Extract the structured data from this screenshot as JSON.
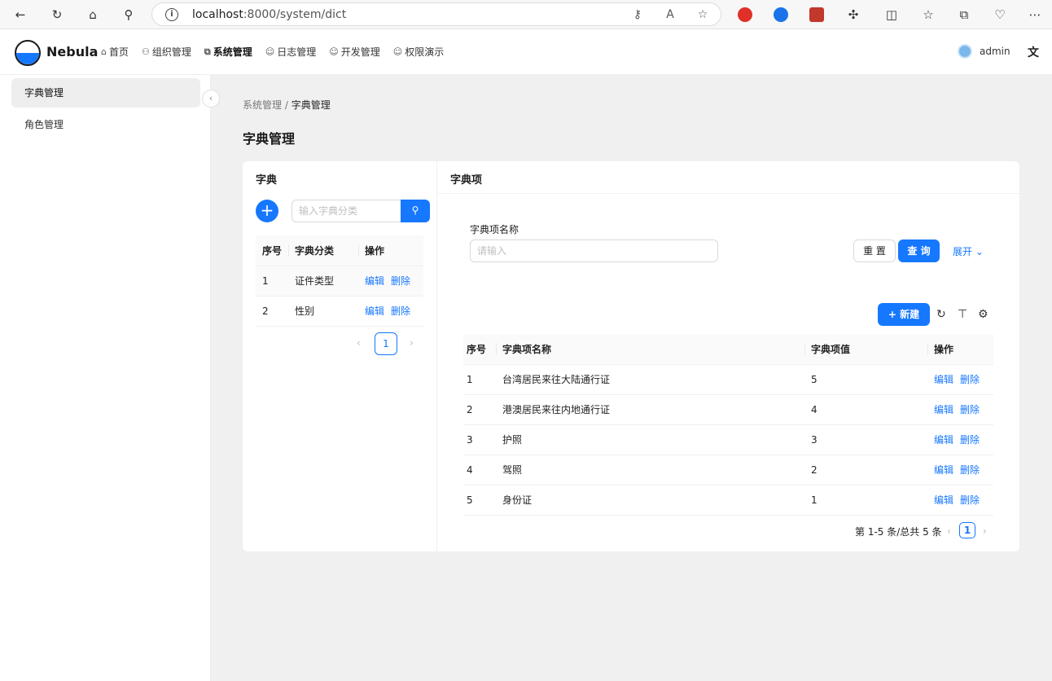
{
  "browser": {
    "url_host": "localhost",
    "url_path": ":8000/system/dict"
  },
  "header": {
    "brand": "Nebula",
    "nav": [
      {
        "label": "首页",
        "icon": "home-icon",
        "glyph": "⌂"
      },
      {
        "label": "组织管理",
        "icon": "org-icon",
        "glyph": "⚇"
      },
      {
        "label": "系统管理",
        "icon": "system-icon",
        "glyph": "⧉"
      },
      {
        "label": "日志管理",
        "icon": "check-circle-icon",
        "glyph": "☺"
      },
      {
        "label": "开发管理",
        "icon": "check-circle-icon",
        "glyph": "☺"
      },
      {
        "label": "权限演示",
        "icon": "check-circle-icon",
        "glyph": "☺"
      }
    ],
    "user": "admin"
  },
  "sidebar": {
    "items": [
      {
        "label": "字典管理"
      },
      {
        "label": "角色管理"
      }
    ]
  },
  "breadcrumb": {
    "parent": "系统管理",
    "sep": "/",
    "current": "字典管理"
  },
  "page_title": "字典管理",
  "dict_panel": {
    "title": "字典",
    "search_placeholder": "输入字典分类",
    "columns": [
      "序号",
      "字典分类",
      "操作"
    ],
    "rows": [
      {
        "no": "1",
        "name": "证件类型",
        "edit": "编辑",
        "del": "删除"
      },
      {
        "no": "2",
        "name": "性别",
        "edit": "编辑",
        "del": "删除"
      }
    ],
    "page": "1"
  },
  "item_panel": {
    "title": "字典项",
    "filter_label": "字典项名称",
    "filter_placeholder": "请输入",
    "reset": "重 置",
    "query": "查 询",
    "expand": "展开",
    "new": "新建",
    "columns": [
      "序号",
      "字典项名称",
      "字典项值",
      "操作"
    ],
    "rows": [
      {
        "no": "1",
        "name": "台湾居民来往大陆通行证",
        "value": "5",
        "edit": "编辑",
        "del": "删除"
      },
      {
        "no": "2",
        "name": "港澳居民来往内地通行证",
        "value": "4",
        "edit": "编辑",
        "del": "删除"
      },
      {
        "no": "3",
        "name": "护照",
        "value": "3",
        "edit": "编辑",
        "del": "删除"
      },
      {
        "no": "4",
        "name": "驾照",
        "value": "2",
        "edit": "编辑",
        "del": "删除"
      },
      {
        "no": "5",
        "name": "身份证",
        "value": "1",
        "edit": "编辑",
        "del": "删除"
      }
    ],
    "total": "第 1-5 条/总共 5 条",
    "page": "1"
  },
  "colors": {
    "primary": "#1677ff"
  }
}
